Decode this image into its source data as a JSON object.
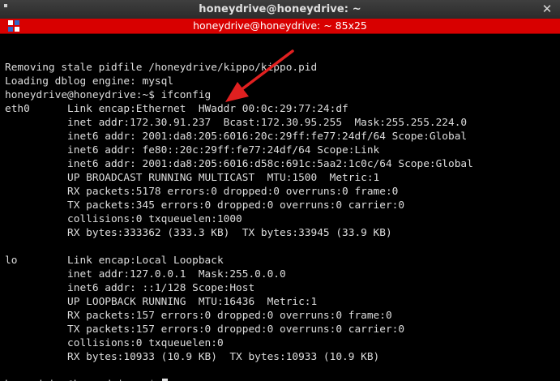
{
  "window": {
    "title": "honeydrive@honeydrive: ~",
    "close_glyph": "✕"
  },
  "tab": {
    "title": "honeydrive@honeydrive: ~ 85x25"
  },
  "terminal": {
    "lines": [
      "",
      "Removing stale pidfile /honeydrive/kippo/kippo.pid",
      "Loading dblog engine: mysql",
      "honeydrive@honeydrive:~$ ifconfig",
      "eth0      Link encap:Ethernet  HWaddr 00:0c:29:77:24:df  ",
      "          inet addr:172.30.91.237  Bcast:172.30.95.255  Mask:255.255.224.0",
      "          inet6 addr: 2001:da8:205:6016:20c:29ff:fe77:24df/64 Scope:Global",
      "          inet6 addr: fe80::20c:29ff:fe77:24df/64 Scope:Link",
      "          inet6 addr: 2001:da8:205:6016:d58c:691c:5aa2:1c0c/64 Scope:Global",
      "          UP BROADCAST RUNNING MULTICAST  MTU:1500  Metric:1",
      "          RX packets:5178 errors:0 dropped:0 overruns:0 frame:0",
      "          TX packets:345 errors:0 dropped:0 overruns:0 carrier:0",
      "          collisions:0 txqueuelen:1000 ",
      "          RX bytes:333362 (333.3 KB)  TX bytes:33945 (33.9 KB)",
      "",
      "lo        Link encap:Local Loopback  ",
      "          inet addr:127.0.0.1  Mask:255.0.0.0",
      "          inet6 addr: ::1/128 Scope:Host",
      "          UP LOOPBACK RUNNING  MTU:16436  Metric:1",
      "          RX packets:157 errors:0 dropped:0 overruns:0 frame:0",
      "          TX packets:157 errors:0 dropped:0 overruns:0 carrier:0",
      "          collisions:0 txqueuelen:0 ",
      "          RX bytes:10933 (10.9 KB)  TX bytes:10933 (10.9 KB)",
      "",
      "honeydrive@honeydrive:~$ "
    ]
  },
  "colors": {
    "tab_bar": "#d80000",
    "annotation_arrow": "#e02020",
    "terminal_bg": "#000000",
    "terminal_fg": "#dedede"
  },
  "icons": {
    "tab_icon": "terminal-icon",
    "annotation": "red-arrow-icon"
  }
}
